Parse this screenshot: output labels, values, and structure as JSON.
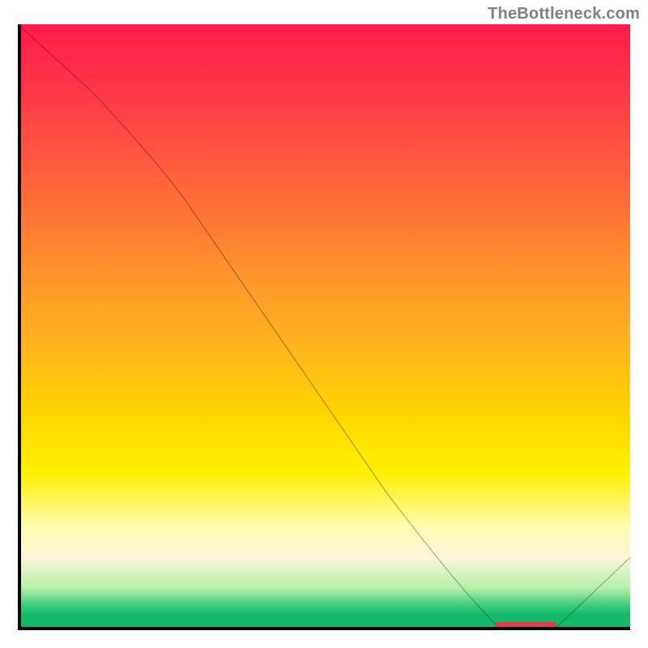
{
  "attribution": "TheBottleneck.com",
  "chart_data": {
    "type": "line",
    "title": "",
    "xlabel": "",
    "ylabel": "",
    "xlim": [
      0,
      100
    ],
    "ylim": [
      0,
      100
    ],
    "grid": false,
    "legend": false,
    "background_gradient": {
      "orientation": "vertical",
      "stops": [
        {
          "pos": 0,
          "color": "#ff1a4b"
        },
        {
          "pos": 22,
          "color": "#ff5640"
        },
        {
          "pos": 52,
          "color": "#ffb220"
        },
        {
          "pos": 74,
          "color": "#fff000"
        },
        {
          "pos": 88,
          "color": "#fdf6d8"
        },
        {
          "pos": 96,
          "color": "#3acb7a"
        },
        {
          "pos": 100,
          "color": "#12b86c"
        }
      ]
    },
    "series": [
      {
        "name": "curve",
        "color": "#000000",
        "points": [
          {
            "x": 0,
            "y": 100
          },
          {
            "x": 12,
            "y": 89
          },
          {
            "x": 24,
            "y": 76
          },
          {
            "x": 36,
            "y": 58
          },
          {
            "x": 48,
            "y": 40
          },
          {
            "x": 60,
            "y": 23
          },
          {
            "x": 72,
            "y": 7
          },
          {
            "x": 78,
            "y": 1
          },
          {
            "x": 83,
            "y": 0
          },
          {
            "x": 88,
            "y": 0.5
          },
          {
            "x": 94,
            "y": 5
          },
          {
            "x": 100,
            "y": 12
          }
        ]
      }
    ],
    "markers": [
      {
        "name": "optimum-band",
        "x_start": 78,
        "x_end": 88,
        "y": 0,
        "color": "#e04040"
      }
    ]
  }
}
